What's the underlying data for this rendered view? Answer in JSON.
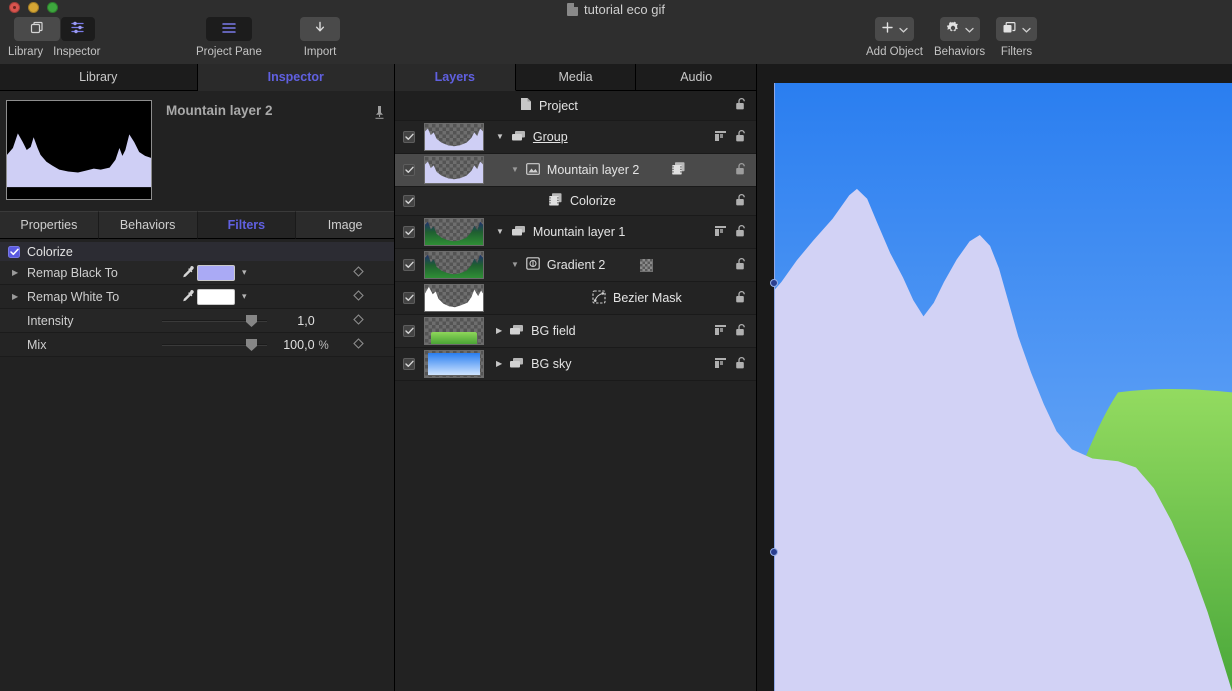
{
  "window": {
    "title": "tutorial eco gif",
    "doc_icon": "document-icon"
  },
  "toolbar": {
    "left_buttons": [
      {
        "label": "Library",
        "icon": "library-icon"
      },
      {
        "label": "Inspector",
        "icon": "inspector-sliders-icon",
        "active": true
      }
    ],
    "project_pane": {
      "label": "Project Pane",
      "icon": "list-lines-icon"
    },
    "import": {
      "label": "Import",
      "icon": "download-arrow-icon"
    },
    "right_buttons": [
      {
        "label": "Add Object",
        "icon": "plus-icon"
      },
      {
        "label": "Behaviors",
        "icon": "gear-icon"
      },
      {
        "label": "Filters",
        "icon": "filters-stack-icon"
      }
    ]
  },
  "inspector": {
    "tabs": [
      {
        "label": "Library",
        "active": false
      },
      {
        "label": "Inspector",
        "active": true
      }
    ],
    "object_name": "Mountain layer 2",
    "pin_icon": "pin-icon",
    "sub_tabs": [
      {
        "label": "Properties",
        "active": false
      },
      {
        "label": "Behaviors",
        "active": false
      },
      {
        "label": "Filters",
        "active": true
      },
      {
        "label": "Image",
        "active": false
      }
    ],
    "filter": {
      "name": "Colorize",
      "enabled": true,
      "parameters": [
        {
          "label": "Remap Black To",
          "type": "color",
          "color": "#aaaaf5",
          "eyedropper": true,
          "disclosure": true
        },
        {
          "label": "Remap White To",
          "type": "color",
          "color": "#ffffff",
          "eyedropper": true,
          "disclosure": true
        },
        {
          "label": "Intensity",
          "type": "slider",
          "value": "1,0",
          "unit": "",
          "slider_pct": 82
        },
        {
          "label": "Mix",
          "type": "slider",
          "value": "100,0",
          "unit": "%",
          "slider_pct": 82
        }
      ]
    }
  },
  "layers_panel": {
    "tabs": [
      {
        "label": "Layers",
        "active": true
      },
      {
        "label": "Media",
        "active": false
      },
      {
        "label": "Audio",
        "active": false
      }
    ],
    "rows": [
      {
        "name": "Project",
        "kind": "project",
        "indent": 0,
        "checkbox": null,
        "thumb": null,
        "disclosure": null,
        "type_icon": "page-icon",
        "lock_icon": "unlocked-padlock-icon",
        "mask_icon": null,
        "filter_icon": null,
        "selected": false
      },
      {
        "name": "Group",
        "kind": "group",
        "indent": 0,
        "checkbox": true,
        "thumb": "mountain-lavender",
        "disclosure": "down",
        "type_icon": "group-icon",
        "lock_icon": "unlocked-padlock-icon",
        "mask_icon": "layer-align-icon",
        "filter_icon": null,
        "underline": true,
        "selected": false
      },
      {
        "name": "Mountain layer 2",
        "kind": "image",
        "indent": 1,
        "checkbox": true,
        "thumb": "mountain-lavender",
        "disclosure": "down",
        "type_icon": "image-icon",
        "lock_icon": "unlocked-padlock-icon",
        "mask_icon": null,
        "filter_icon": "filter-badge-icon",
        "selected": true
      },
      {
        "name": "Colorize",
        "kind": "filter",
        "indent": 2,
        "checkbox": true,
        "thumb": null,
        "disclosure": null,
        "type_icon": "filter-badge-icon",
        "lock_icon": "unlocked-padlock-icon",
        "mask_icon": null,
        "filter_icon": null,
        "selected": false
      },
      {
        "name": "Mountain layer 1",
        "kind": "group",
        "indent": 0,
        "checkbox": true,
        "thumb": "mountain-green",
        "disclosure": "down",
        "type_icon": "group-icon",
        "lock_icon": "unlocked-padlock-icon",
        "mask_icon": "layer-align-icon",
        "filter_icon": null,
        "selected": false
      },
      {
        "name": "Gradient 2",
        "kind": "gradient",
        "indent": 1,
        "checkbox": true,
        "thumb": "mountain-green",
        "disclosure": "down",
        "type_icon": "gradient-icon",
        "lock_icon": "unlocked-padlock-icon",
        "mask_icon": null,
        "filter_icon": null,
        "checker_badge": true,
        "selected": false
      },
      {
        "name": "Bezier Mask",
        "kind": "mask",
        "indent": 2,
        "checkbox": true,
        "thumb": "mountain-white",
        "disclosure": null,
        "type_icon": "bezier-mask-icon",
        "lock_icon": "unlocked-padlock-icon",
        "mask_icon": null,
        "filter_icon": null,
        "selected": false
      },
      {
        "name": "BG field",
        "kind": "group",
        "indent": 0,
        "checkbox": true,
        "thumb": "green-bar",
        "disclosure": "right",
        "type_icon": "group-icon",
        "lock_icon": "unlocked-padlock-icon",
        "mask_icon": "layer-align-icon",
        "filter_icon": null,
        "selected": false
      },
      {
        "name": "BG sky",
        "kind": "group",
        "indent": 0,
        "checkbox": true,
        "thumb": "blue-sky",
        "disclosure": "right",
        "type_icon": "group-icon",
        "lock_icon": "unlocked-padlock-icon",
        "mask_icon": "layer-align-icon",
        "filter_icon": null,
        "selected": false
      }
    ]
  },
  "canvas": {
    "sky_top_color": "#2a7ef0",
    "sky_bottom_color": "#bfdcff",
    "mountain_color": "#d2d2f5",
    "field_color_top": "#8ed65a",
    "field_color_bottom": "#4aa83a",
    "selection_handles": 2,
    "selection_color": "#95aee8"
  },
  "colors": {
    "accent": "#6060e0",
    "panel_bg": "#222222",
    "toolbar_bg": "#2e2e2e",
    "canvas_bg": "#1a1a1a"
  }
}
